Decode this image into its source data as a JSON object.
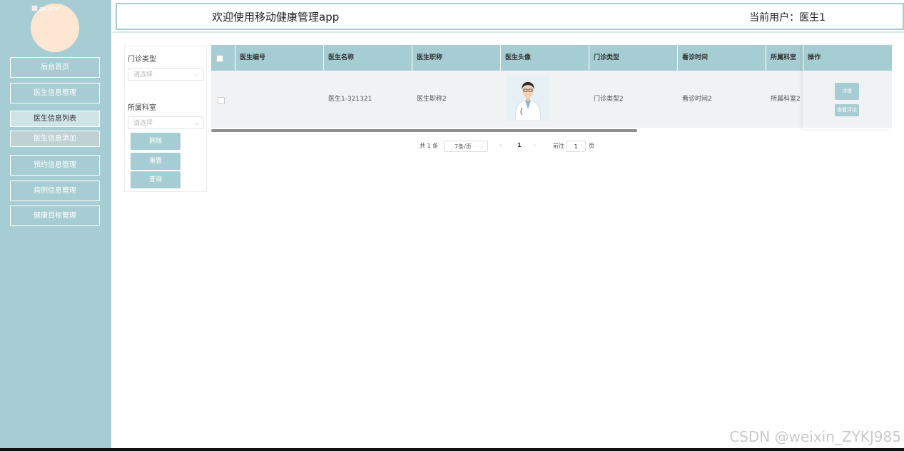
{
  "sidebar": {
    "avatar_alt": "avatar",
    "items": [
      {
        "label": "后台首页"
      },
      {
        "label": "医生信息管理"
      },
      {
        "label": "医生信息列表"
      },
      {
        "label": "医生信息添加"
      },
      {
        "label": "预约信息管理"
      },
      {
        "label": "病例信息管理"
      },
      {
        "label": "健康目标管理"
      }
    ]
  },
  "header": {
    "title": "欢迎使用移动健康管理app",
    "user": "当前用户：医生1"
  },
  "filter": {
    "clinic_type_label": "门诊类型",
    "clinic_type_placeholder": "请选择",
    "department_label": "所属科室",
    "department_placeholder": "请选择",
    "delete_label": "删除",
    "reset_label": "重置",
    "query_label": "查询"
  },
  "table": {
    "columns": [
      "医生编号",
      "医生名称",
      "医生职称",
      "医生头像",
      "门诊类型",
      "看诊时间",
      "所属科室",
      "操作"
    ],
    "rows": [
      {
        "doctor_id": "",
        "name": "医生1-321321",
        "title": "医生职称2",
        "clinic_type": "门诊类型2",
        "visit_time": "看诊时间2",
        "department": "所属科室2",
        "detail_label": "详情",
        "reviews_label": "查看评论"
      }
    ]
  },
  "pagination": {
    "total": "共 1 条",
    "page_size": "7条/页",
    "current_page": "1",
    "goto_label": "前往",
    "goto_value": "1",
    "page_suffix": "页"
  },
  "watermark": "CSDN @weixin_ZYKJ985",
  "colors": {
    "accent": "#a6cdd3",
    "avatar_bg": "#fde6d2"
  }
}
